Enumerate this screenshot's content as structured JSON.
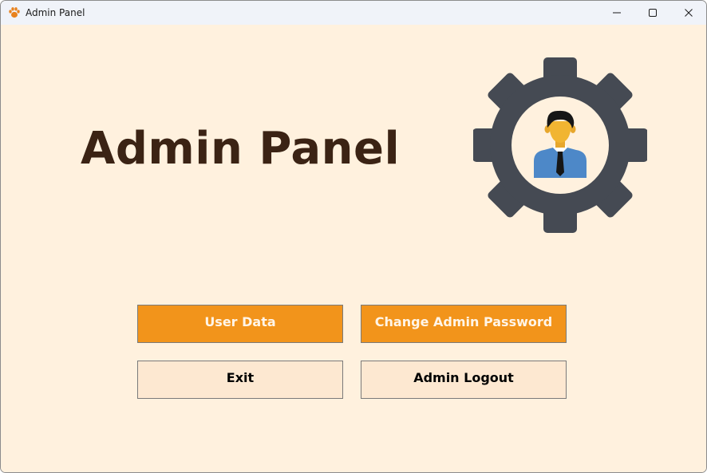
{
  "window": {
    "title": "Admin Panel",
    "app_icon": "paw-icon",
    "controls": {
      "minimize": "minimize-icon",
      "maximize": "maximize-icon",
      "close": "close-icon"
    }
  },
  "main": {
    "heading": "Admin Panel",
    "illustration": "admin-gear-user-icon",
    "buttons": {
      "user_data": "User Data",
      "change_password": "Change Admin Password",
      "exit": "Exit",
      "logout": "Admin Logout"
    }
  },
  "colors": {
    "background": "#fff1de",
    "heading": "#3b2314",
    "primary_button": "#f2941b",
    "secondary_button": "#fde8d1",
    "gear": "#454a53",
    "app_icon": "#e8821e"
  }
}
